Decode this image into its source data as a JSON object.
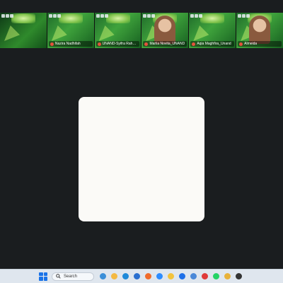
{
  "participants": [
    {
      "name": "",
      "style": "dark"
    },
    {
      "name": "Nazira Nadhifah",
      "style": "plain"
    },
    {
      "name": "UNAND-Syifra Rahmatunisa",
      "style": "plain"
    },
    {
      "name": "Marlia Novita_UNAND",
      "style": "person"
    },
    {
      "name": "Aqia Maghfira_Unand",
      "style": "plain"
    },
    {
      "name": "Almeida",
      "style": "person"
    }
  ],
  "taskbar": {
    "search_label": "Search",
    "icons": [
      {
        "name": "widget-icon",
        "color": "#3b8fd8"
      },
      {
        "name": "folder-icon",
        "color": "#f4b942"
      },
      {
        "name": "edge-icon",
        "color": "#1f8ad9"
      },
      {
        "name": "store-icon",
        "color": "#2a6fcf"
      },
      {
        "name": "firefox-icon",
        "color": "#f06b2b"
      },
      {
        "name": "zoom-icon",
        "color": "#2d8cff"
      },
      {
        "name": "files-icon",
        "color": "#f3c33c"
      },
      {
        "name": "dropbox-icon",
        "color": "#1e6fe8"
      },
      {
        "name": "mail-icon",
        "color": "#4a88d8"
      },
      {
        "name": "app-icon",
        "color": "#e03a3a"
      },
      {
        "name": "whatsapp-icon",
        "color": "#25d366"
      },
      {
        "name": "chrome-icon",
        "color": "#e8b23a"
      },
      {
        "name": "media-icon",
        "color": "#333333"
      }
    ]
  }
}
